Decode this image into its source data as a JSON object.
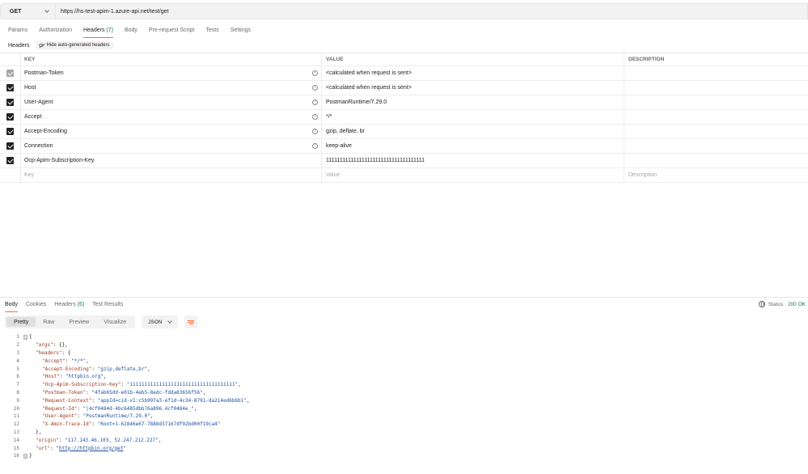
{
  "request": {
    "method": "GET",
    "url": "https://hs-test-apim-1.azure-api.net/test/get"
  },
  "request_tabs": [
    {
      "label": "Params"
    },
    {
      "label": "Authorization"
    },
    {
      "label": "Headers",
      "count": "(7)",
      "active": true
    },
    {
      "label": "Body"
    },
    {
      "label": "Pre-request Script"
    },
    {
      "label": "Tests"
    },
    {
      "label": "Settings"
    }
  ],
  "headers_section": {
    "title": "Headers",
    "hide_button": "Hide auto-generated headers"
  },
  "headers_table": {
    "columns": {
      "key": "KEY",
      "value": "VALUE",
      "description": "DESCRIPTION"
    },
    "rows": [
      {
        "key": "Postman-Token",
        "value": "<calculated when request is sent>",
        "auto": true,
        "dim": true
      },
      {
        "key": "Host",
        "value": "<calculated when request is sent>",
        "auto": true
      },
      {
        "key": "User-Agent",
        "value": "PostmanRuntime/7.29.0",
        "auto": true
      },
      {
        "key": "Accept",
        "value": "*/*",
        "auto": true
      },
      {
        "key": "Accept-Encoding",
        "value": "gzip, deflate, br",
        "auto": true
      },
      {
        "key": "Connection",
        "value": "keep-alive",
        "auto": true
      },
      {
        "key": "Ocp-Apim-Subscription-Key",
        "value": "111111111111111111111111111111111111",
        "auto": false
      }
    ],
    "placeholder": {
      "key": "Key",
      "value": "Value",
      "description": "Description"
    }
  },
  "response_tabs": [
    {
      "label": "Body",
      "active": true
    },
    {
      "label": "Cookies"
    },
    {
      "label": "Headers",
      "count": "(6)"
    },
    {
      "label": "Test Results"
    }
  ],
  "status": {
    "label": "Status:",
    "value": "200 OK"
  },
  "view_modes": [
    {
      "label": "Pretty",
      "active": true
    },
    {
      "label": "Raw"
    },
    {
      "label": "Preview"
    },
    {
      "label": "Visualize"
    }
  ],
  "format": "JSON",
  "body_lines": [
    {
      "n": "1",
      "indent": 0,
      "parts": [
        {
          "t": "{",
          "c": "p"
        }
      ],
      "fold": true
    },
    {
      "n": "2",
      "indent": 1,
      "parts": [
        {
          "t": "\"args\"",
          "c": "k"
        },
        {
          "t": ": {},",
          "c": "p"
        }
      ]
    },
    {
      "n": "3",
      "indent": 1,
      "parts": [
        {
          "t": "\"headers\"",
          "c": "k"
        },
        {
          "t": ": {",
          "c": "p"
        }
      ]
    },
    {
      "n": "4",
      "indent": 2,
      "parts": [
        {
          "t": "\"Accept\"",
          "c": "k"
        },
        {
          "t": ": ",
          "c": "p"
        },
        {
          "t": "\"*/*\"",
          "c": "s"
        },
        {
          "t": ",",
          "c": "p"
        }
      ]
    },
    {
      "n": "5",
      "indent": 2,
      "parts": [
        {
          "t": "\"Accept-Encoding\"",
          "c": "k"
        },
        {
          "t": ": ",
          "c": "p"
        },
        {
          "t": "\"gzip,deflate,br\"",
          "c": "s"
        },
        {
          "t": ",",
          "c": "p"
        }
      ]
    },
    {
      "n": "6",
      "indent": 2,
      "parts": [
        {
          "t": "\"Host\"",
          "c": "k"
        },
        {
          "t": ": ",
          "c": "p"
        },
        {
          "t": "\"httpbin.org\"",
          "c": "s"
        },
        {
          "t": ",",
          "c": "p"
        }
      ]
    },
    {
      "n": "7",
      "indent": 2,
      "parts": [
        {
          "t": "\"Ocp-Apim-Subscription-Key\"",
          "c": "k"
        },
        {
          "t": ": ",
          "c": "p"
        },
        {
          "t": "\"111111111111111111111111111111111111\"",
          "c": "s"
        },
        {
          "t": ",",
          "c": "p"
        }
      ]
    },
    {
      "n": "8",
      "indent": 2,
      "parts": [
        {
          "t": "\"Postman-Token\"",
          "c": "k"
        },
        {
          "t": ": ",
          "c": "p"
        },
        {
          "t": "\"4fab65dd-e01b-4eb5-8edc-fdda83656f56\"",
          "c": "s"
        },
        {
          "t": ",",
          "c": "p"
        }
      ]
    },
    {
      "n": "9",
      "indent": 2,
      "parts": [
        {
          "t": "\"Request-Context\"",
          "c": "k"
        },
        {
          "t": ": ",
          "c": "p"
        },
        {
          "t": "\"appId=cid-v1:c5b997a3-ef1d-4c34-8791-da214ed6b6b1\"",
          "c": "s"
        },
        {
          "t": ",",
          "c": "p"
        }
      ]
    },
    {
      "n": "10",
      "indent": 2,
      "parts": [
        {
          "t": "\"Request-Id\"",
          "c": "k"
        },
        {
          "t": ": ",
          "c": "p"
        },
        {
          "t": "\"|4cf0484d-4bc6485dbb76a896.4cf0484e_\"",
          "c": "s"
        },
        {
          "t": ",",
          "c": "p"
        }
      ]
    },
    {
      "n": "11",
      "indent": 2,
      "parts": [
        {
          "t": "\"User-Agent\"",
          "c": "k"
        },
        {
          "t": ": ",
          "c": "p"
        },
        {
          "t": "\"PostmanRuntime/7.29.0\"",
          "c": "s"
        },
        {
          "t": ",",
          "c": "p"
        }
      ]
    },
    {
      "n": "12",
      "indent": 2,
      "parts": [
        {
          "t": "\"X-Amzn-Trace-Id\"",
          "c": "k"
        },
        {
          "t": ": ",
          "c": "p"
        },
        {
          "t": "\"Root=1-62846e67-7888d37167df92bd00f19ca4\"",
          "c": "s"
        }
      ]
    },
    {
      "n": "13",
      "indent": 1,
      "parts": [
        {
          "t": "},",
          "c": "p"
        }
      ]
    },
    {
      "n": "14",
      "indent": 1,
      "parts": [
        {
          "t": "\"origin\"",
          "c": "k"
        },
        {
          "t": ": ",
          "c": "p"
        },
        {
          "t": "\"117.143.46.103, 52.247.212.227\"",
          "c": "s"
        },
        {
          "t": ",",
          "c": "p"
        }
      ]
    },
    {
      "n": "15",
      "indent": 1,
      "parts": [
        {
          "t": "\"url\"",
          "c": "k"
        },
        {
          "t": ": ",
          "c": "p"
        },
        {
          "t": "\"",
          "c": "s"
        },
        {
          "t": "http://httpbin.org/get",
          "c": "lnk"
        },
        {
          "t": "\"",
          "c": "s"
        }
      ]
    },
    {
      "n": "16",
      "indent": 0,
      "parts": [
        {
          "t": "}",
          "c": "p"
        }
      ],
      "fold": true
    }
  ],
  "icons": {
    "method_dropdown": "chevron-down-icon",
    "hide_headers": "eye-slash-icon",
    "info": "info-icon",
    "status": "globe-icon",
    "wrap": "wrap-lines-icon"
  },
  "colors": {
    "accent": "#ff6c37",
    "success": "#0f7b3e",
    "key": "#a0381d",
    "string": "#1a4f9c"
  }
}
